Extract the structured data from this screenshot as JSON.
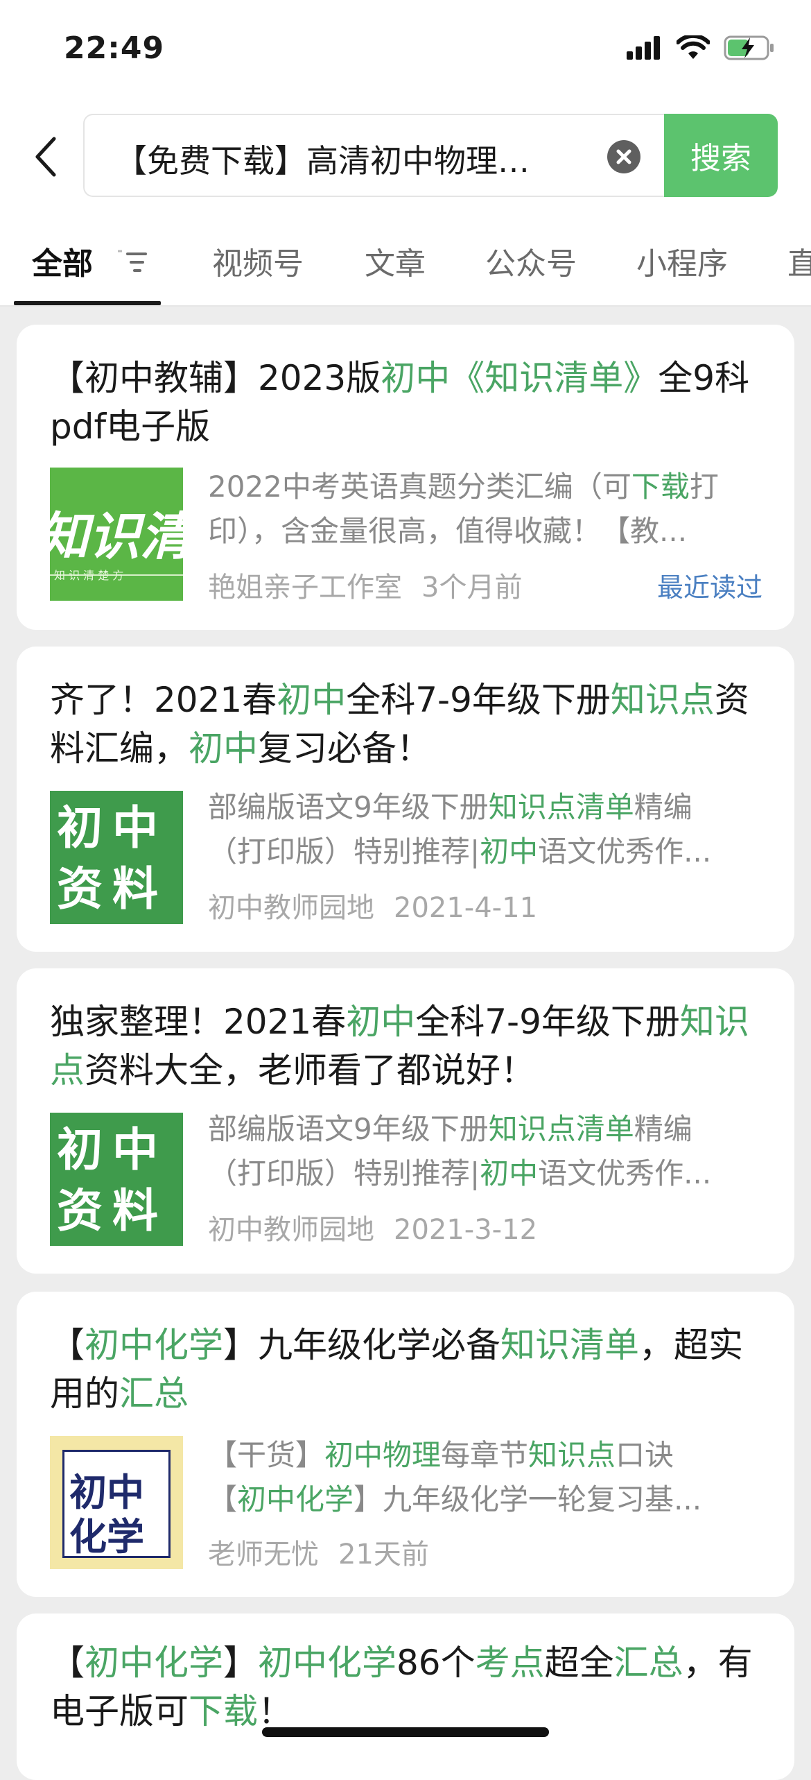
{
  "status_bar": {
    "time": "22:49"
  },
  "search": {
    "query": "【免费下载】高清初中物理…",
    "button_label": "搜索"
  },
  "tabs": [
    {
      "label": "全部",
      "active": true
    },
    {
      "label": "视频号",
      "active": false
    },
    {
      "label": "文章",
      "active": false
    },
    {
      "label": "公众号",
      "active": false
    },
    {
      "label": "小程序",
      "active": false
    },
    {
      "label": "直",
      "active": false
    }
  ],
  "results": [
    {
      "title_parts": [
        {
          "text": "【初中教辅】2023版",
          "hl": false
        },
        {
          "text": "初中《知识清单》",
          "hl": true
        },
        {
          "text": "全9科 pdf电子版",
          "hl": false
        }
      ],
      "thumb_text": "知识清",
      "thumb_sub": "知 识 清 楚    方",
      "snippet_line1": [
        {
          "text": "2022中考英语真题分类汇编（可",
          "hl": false
        },
        {
          "text": "下载",
          "hl": true
        },
        {
          "text": "打",
          "hl": false
        }
      ],
      "snippet_line2": [
        {
          "text": "印），含金量很高，值得收藏！【教...",
          "hl": false
        }
      ],
      "source": "艳姐亲子工作室",
      "date": "3个月前",
      "badge": "最近读过"
    },
    {
      "title_parts": [
        {
          "text": "齐了！2021春",
          "hl": false
        },
        {
          "text": "初中",
          "hl": true
        },
        {
          "text": "全科7-9年级下册",
          "hl": false
        },
        {
          "text": "知识点",
          "hl": true
        },
        {
          "text": "资料汇编，",
          "hl": false
        },
        {
          "text": "初中",
          "hl": true
        },
        {
          "text": "复习必备！",
          "hl": false
        }
      ],
      "thumb_text": "初中资料",
      "thumb_sub": "",
      "snippet_line1": [
        {
          "text": "部编版语文9年级下册",
          "hl": false
        },
        {
          "text": "知识点清单",
          "hl": true
        },
        {
          "text": "精编",
          "hl": false
        }
      ],
      "snippet_line2": [
        {
          "text": "（打印版）特别推荐|",
          "hl": false
        },
        {
          "text": "初中",
          "hl": true
        },
        {
          "text": "语文优秀作...",
          "hl": false
        }
      ],
      "source": "初中教师园地",
      "date": "2021-4-11",
      "badge": ""
    },
    {
      "title_parts": [
        {
          "text": "独家整理！2021春",
          "hl": false
        },
        {
          "text": "初中",
          "hl": true
        },
        {
          "text": "全科7-9年级下册",
          "hl": false
        },
        {
          "text": "知识点",
          "hl": true
        },
        {
          "text": "资料大全，老师看了都说好！",
          "hl": false
        }
      ],
      "thumb_text": "初中资料",
      "thumb_sub": "",
      "snippet_line1": [
        {
          "text": "部编版语文9年级下册",
          "hl": false
        },
        {
          "text": "知识点清单",
          "hl": true
        },
        {
          "text": "精编",
          "hl": false
        }
      ],
      "snippet_line2": [
        {
          "text": "（打印版）特别推荐|",
          "hl": false
        },
        {
          "text": "初中",
          "hl": true
        },
        {
          "text": "语文优秀作...",
          "hl": false
        }
      ],
      "source": "初中教师园地",
      "date": "2021-3-12",
      "badge": ""
    },
    {
      "title_parts": [
        {
          "text": "【",
          "hl": false
        },
        {
          "text": "初中化学",
          "hl": true
        },
        {
          "text": "】九年级化学必备",
          "hl": false
        },
        {
          "text": "知识清单",
          "hl": true
        },
        {
          "text": "，超实用的",
          "hl": false
        },
        {
          "text": "汇总",
          "hl": true
        }
      ],
      "thumb_text": "初中化学",
      "thumb_sub": "",
      "snippet_line1": [
        {
          "text": "【干货】",
          "hl": false
        },
        {
          "text": "初中物理",
          "hl": true
        },
        {
          "text": "每章节",
          "hl": false
        },
        {
          "text": "知识点",
          "hl": true
        },
        {
          "text": "口诀",
          "hl": false
        }
      ],
      "snippet_line2": [
        {
          "text": "【",
          "hl": false
        },
        {
          "text": "初中化学",
          "hl": true
        },
        {
          "text": "】九年级化学一轮复习基...",
          "hl": false
        }
      ],
      "source": "老师无忧",
      "date": "21天前",
      "badge": ""
    },
    {
      "title_parts": [
        {
          "text": "【",
          "hl": false
        },
        {
          "text": "初中化学",
          "hl": true
        },
        {
          "text": "】",
          "hl": false
        },
        {
          "text": "初中化学",
          "hl": true
        },
        {
          "text": "86个",
          "hl": false
        },
        {
          "text": "考点",
          "hl": true
        },
        {
          "text": "超全",
          "hl": false
        },
        {
          "text": "汇总",
          "hl": true
        },
        {
          "text": "，有电子版可",
          "hl": false
        },
        {
          "text": "下载",
          "hl": true
        },
        {
          "text": "！",
          "hl": false
        }
      ]
    }
  ],
  "colors": {
    "accent": "#5cc36e",
    "highlight": "#4aa564",
    "link": "#4a7fc1"
  }
}
